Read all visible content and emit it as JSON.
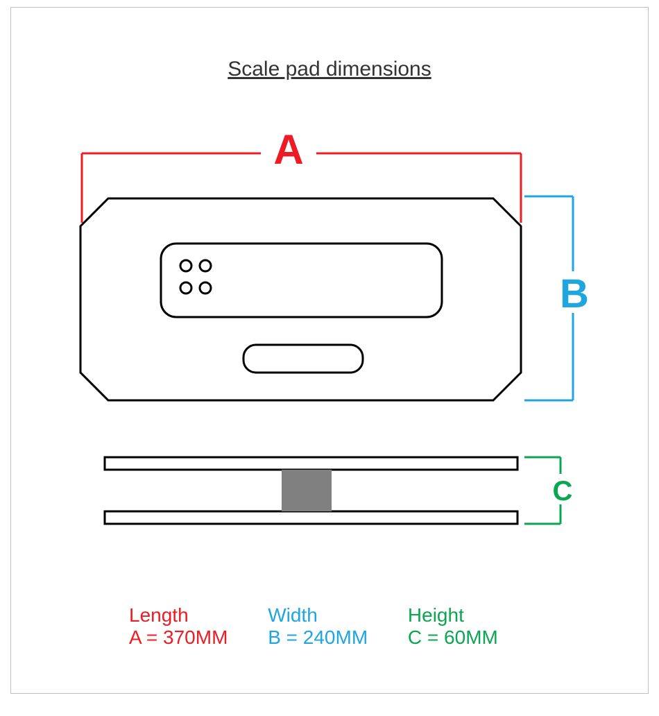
{
  "title": "Scale pad dimensions",
  "labels": {
    "A": "A",
    "B": "B",
    "C": "C"
  },
  "legend": {
    "length": {
      "name": "Length",
      "text": "A = 370MM"
    },
    "width": {
      "name": "Width",
      "text": "B = 240MM"
    },
    "height": {
      "name": "Height",
      "text": "C = 60MM"
    }
  },
  "dimensions": {
    "A_mm": 370,
    "B_mm": 240,
    "C_mm": 60
  },
  "colors": {
    "A": "#ed1c24",
    "B": "#1ea6e0",
    "C": "#0aa651",
    "fill": "#808080"
  }
}
